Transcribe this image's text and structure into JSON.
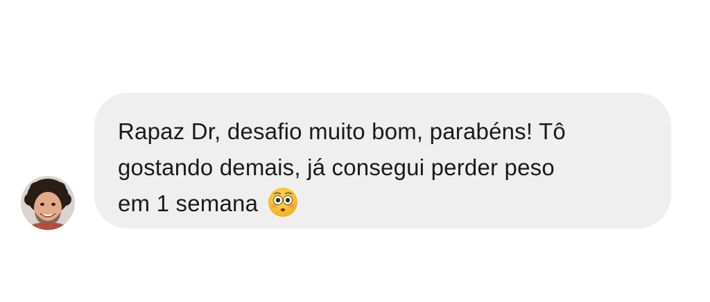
{
  "comment": {
    "lines": [
      "Rapaz Dr, desafio muito bom, parabéns! Tô",
      "gostando demais, já consegui perder peso",
      "em 1 semana"
    ],
    "emoji": "flushed-face"
  },
  "colors": {
    "bubble": "#efefef",
    "text": "#1a1a1a",
    "emoji_face": "#f7c236"
  }
}
